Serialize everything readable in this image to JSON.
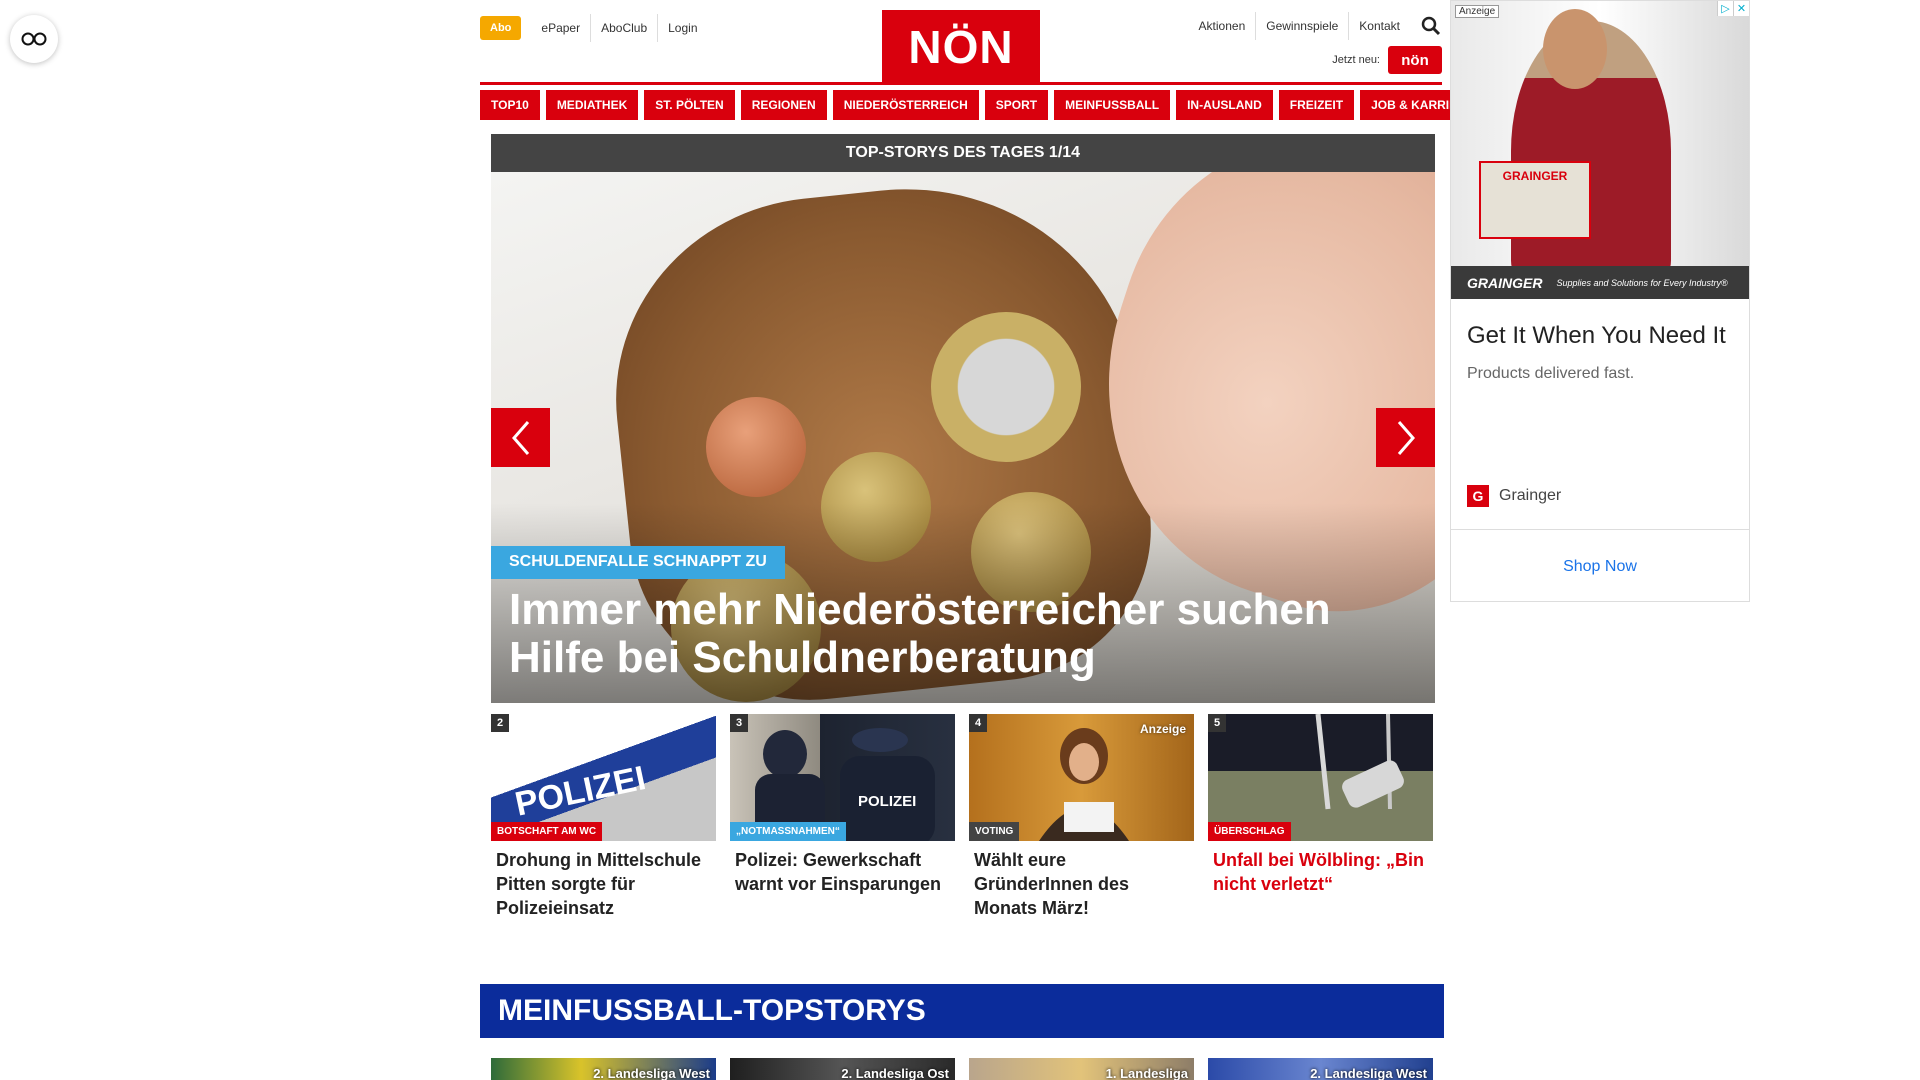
{
  "header": {
    "abo_label": "Abo",
    "links_left": [
      "ePaper",
      "AboClub",
      "Login"
    ],
    "logo_text": "NÖN",
    "links_right": [
      "Aktionen",
      "Gewinnspiele",
      "Kontakt"
    ],
    "jetzt_label": "Jetzt neu:",
    "mini_logo_text": "nön"
  },
  "nav": {
    "items": [
      "TOP10",
      "MEDIATHEK",
      "ST. PÖLTEN",
      "REGIONEN",
      "NIEDERÖSTERREICH",
      "SPORT",
      "MEINFUSSBALL",
      "IN-AUSLAND",
      "FREIZEIT",
      "JOB & KARRIERE"
    ]
  },
  "topstories": {
    "header": "TOP-STORYS DES TAGES 1/14",
    "hero_tag": "SCHULDENFALLE SCHNAPPT ZU",
    "hero_title": "Immer mehr Niederösterreicher suchen Hilfe bei Schuldnerberatung",
    "stories": [
      {
        "num": "2",
        "badge": "BOTSCHAFT AM WC",
        "badge_color": "#d9000d",
        "title": "Drohung in Mittelschule Pitten sorgte für Polizeieinsatz",
        "thumb_text": "POLIZEI",
        "highlight": false,
        "anzeige": ""
      },
      {
        "num": "3",
        "badge": "„NOTMASSNAHMEN“",
        "badge_color": "#3aa7e0",
        "title": "Polizei: Gewerkschaft warnt vor Einsparungen",
        "thumb_text": "POLIZEI",
        "highlight": false,
        "anzeige": ""
      },
      {
        "num": "4",
        "badge": "VOTING",
        "badge_color": "#444444",
        "title": "Wählt eure GründerInnen des Monats März!",
        "thumb_text": "",
        "highlight": false,
        "anzeige": "Anzeige"
      },
      {
        "num": "5",
        "badge": "ÜBERSCHLAG",
        "badge_color": "#d9000d",
        "title": "Unfall bei Wölbling: „Bin nicht verletzt“",
        "thumb_text": "",
        "highlight": true,
        "anzeige": ""
      }
    ]
  },
  "meinfussball": {
    "title": "MEINFUSSBALL-TOPSTORYS",
    "items": [
      "2. Landesliga West",
      "2. Landesliga Ost",
      "1. Landesliga",
      "2. Landesliga West"
    ]
  },
  "ad": {
    "label": "Anzeige",
    "box_label": "GRAINGER",
    "strip_brand": "GRAINGER",
    "strip_tagline": "Supplies and Solutions for Every Industry®",
    "headline": "Get It When You Need It",
    "description": "Products delivered fast.",
    "brand": "Grainger",
    "brand_icon_text": "G",
    "cta": "Shop Now"
  }
}
